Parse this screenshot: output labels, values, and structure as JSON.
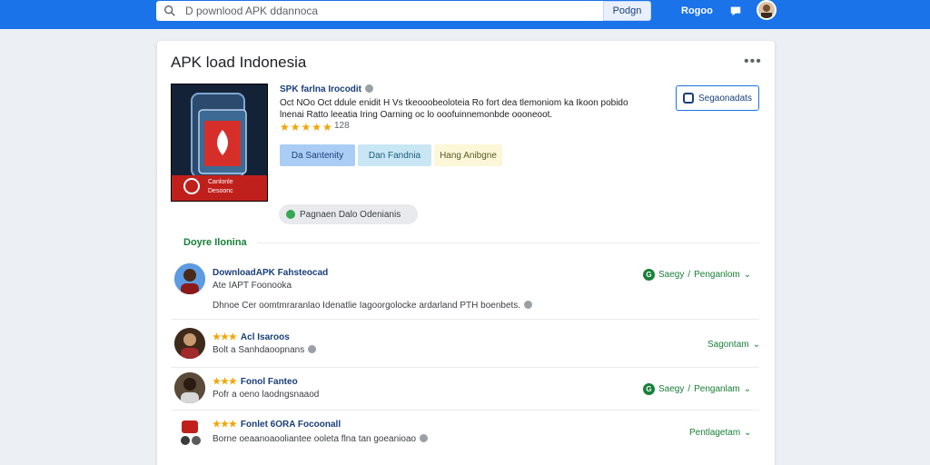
{
  "topbar": {
    "search_value": "D pownlood APK ddannoca",
    "search_button": "Podgn",
    "login_label": "Rogoo"
  },
  "card": {
    "title": "APK load Indonesia",
    "more": "•••",
    "app": {
      "name": "SPK farlna Irocodit",
      "desc": "Oct NOo Oct ddule enidit H Vs tkeooobeoloteia Ro fort dea tlemoniom ka Ikoon pobido lnenai Ratto leeatia Iring Oarning oc lo ooofuinnemonbde oooneoot.",
      "stars": "★★★★★",
      "rating": "128",
      "icon_caption_1": "Canlonle",
      "icon_caption_2": "Desoonc"
    },
    "download_button": "Segaonadats",
    "chips": [
      "Da Santenity",
      "Dan Fandnia",
      "Hang Anibgne"
    ],
    "pill": "Pagnaen Dalo Odenianis",
    "section_title": "Doyre Ilonina"
  },
  "rows": [
    {
      "title": "DownloadAPK Fahsteocad",
      "sub": "Ate IAPT Foonooka",
      "desc": "Dhnoe Cer oomtmraranlao Idenatlie Iagoorgolocke ardarland PTH boenbets.",
      "stars": "",
      "action": "Saegy",
      "action2": "Penganlom",
      "action_badge": "G"
    },
    {
      "title": "Acl Isaroos",
      "sub": "Bolt a Sanhdaoopnans",
      "desc": "",
      "stars": "★★★",
      "action": "",
      "action2": "Sagontam",
      "action_badge": ""
    },
    {
      "title": "Fonol Fanteo",
      "sub": "Pofr a oeno laodngsnaaod",
      "desc": "",
      "stars": "★★★",
      "action": "Saegy",
      "action2": "Penganlam",
      "action_badge": "G"
    },
    {
      "title": "Fonlet 6ORA Focoonall",
      "sub": "Borne oeaanoaooliantee ooleta flna tan goeanioao",
      "desc": "",
      "stars": "★★★",
      "action": "",
      "action2": "Pentlagetam",
      "action_badge": ""
    }
  ],
  "colors": {
    "topbar": "#1a73e8",
    "accent_green": "#188038",
    "star": "#f4a400",
    "link_blue": "#1a3f7a"
  }
}
